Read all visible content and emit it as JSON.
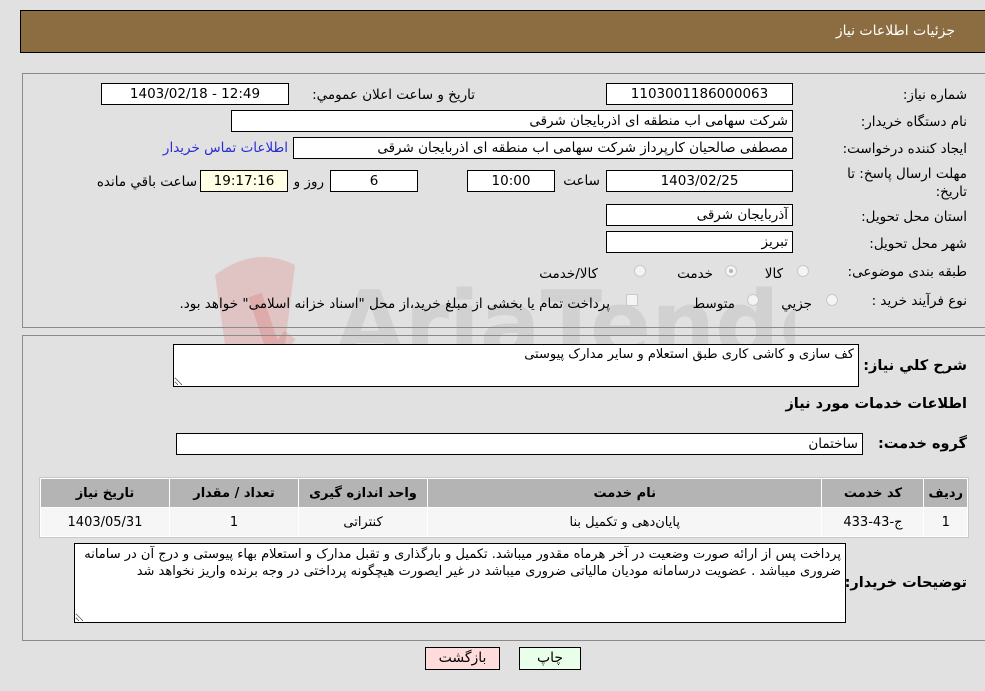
{
  "header": {
    "title": "جزئیات اطلاعات نیاز"
  },
  "fields": {
    "need_number": {
      "label": "شماره نیاز:",
      "value": "1103001186000063"
    },
    "announce_datetime": {
      "label": "تاریخ و ساعت اعلان عمومي:",
      "value": "1403/02/18 - 12:49"
    },
    "buyer_org": {
      "label": "نام دستگاه خریدار:",
      "value": "شرکت سهامی اب منطقه ای اذربایجان شرقی"
    },
    "requester": {
      "label": "ایجاد کننده درخواست:",
      "value": "مصطفی صالحیان کارپرداز شرکت سهامی اب منطقه ای اذربایجان شرقی"
    },
    "buyer_contact_link": "اطلاعات تماس خریدار",
    "deadline": {
      "label": "مهلت ارسال پاسخ: تا تاریخ:",
      "date": "1403/02/25",
      "time_label": "ساعت",
      "time": "10:00",
      "days": "6",
      "days_label": "روز و",
      "remaining": "19:17:16",
      "remaining_label": "ساعت باقي مانده"
    },
    "province": {
      "label": "استان محل تحویل:",
      "value": "آذربایجان شرقی"
    },
    "city": {
      "label": "شهر محل تحویل:",
      "value": "تبریز"
    },
    "category": {
      "label": "طبقه بندی موضوعی:",
      "options": [
        {
          "label": "کالا",
          "checked": false
        },
        {
          "label": "خدمت",
          "checked": true
        },
        {
          "label": "کالا/خدمت",
          "checked": false
        }
      ]
    },
    "purchase_type": {
      "label": "نوع فرآیند خرید :",
      "options": [
        {
          "label": "جزيي",
          "checked": false
        },
        {
          "label": "متوسط",
          "checked": false
        }
      ],
      "treasury_note": "پرداخت تمام یا بخشی از مبلغ خرید،از محل \"اسناد خزانه اسلامی\" خواهد بود."
    }
  },
  "description": {
    "label": "شرح کلي نياز:",
    "value": "کف سازی و کاشی کاری طبق استعلام و سایر مدارک پیوستی"
  },
  "services_section_title": "اطلاعات خدمات مورد نیاز",
  "service_group": {
    "label": "گروه خدمت:",
    "value": "ساختمان"
  },
  "table": {
    "headers": [
      "ردیف",
      "کد خدمت",
      "نام خدمت",
      "واحد اندازه گیری",
      "تعداد / مقدار",
      "تاریخ نیاز"
    ],
    "rows": [
      [
        "1",
        "ج-43-433",
        "پایان‌دهی و تکمیل بنا",
        "کنتراتی",
        "1",
        "1403/05/31"
      ]
    ]
  },
  "buyer_notes": {
    "label": "توضیحات خریدار:",
    "value": "پرداخت پس از ارائه صورت وضعیت در آخر هرماه مقدور میباشد. تکمیل و بارگذاری و تقبل مدارک و استعلام بهاء پیوستی و درج آن در سامانه ضروری میباشد . عضویت درسامانه مودیان مالیاتی ضروری میباشد در غیر ایصورت هیچگونه پرداختی در وجه برنده واریز نخواهد شد"
  },
  "buttons": {
    "print": "چاپ",
    "back": "بازگشت"
  },
  "colors": {
    "header_bg": "#8c6d42",
    "print_bg": "#eaffea",
    "back_bg": "#ffdcdc",
    "link": "#2b2bd9"
  }
}
